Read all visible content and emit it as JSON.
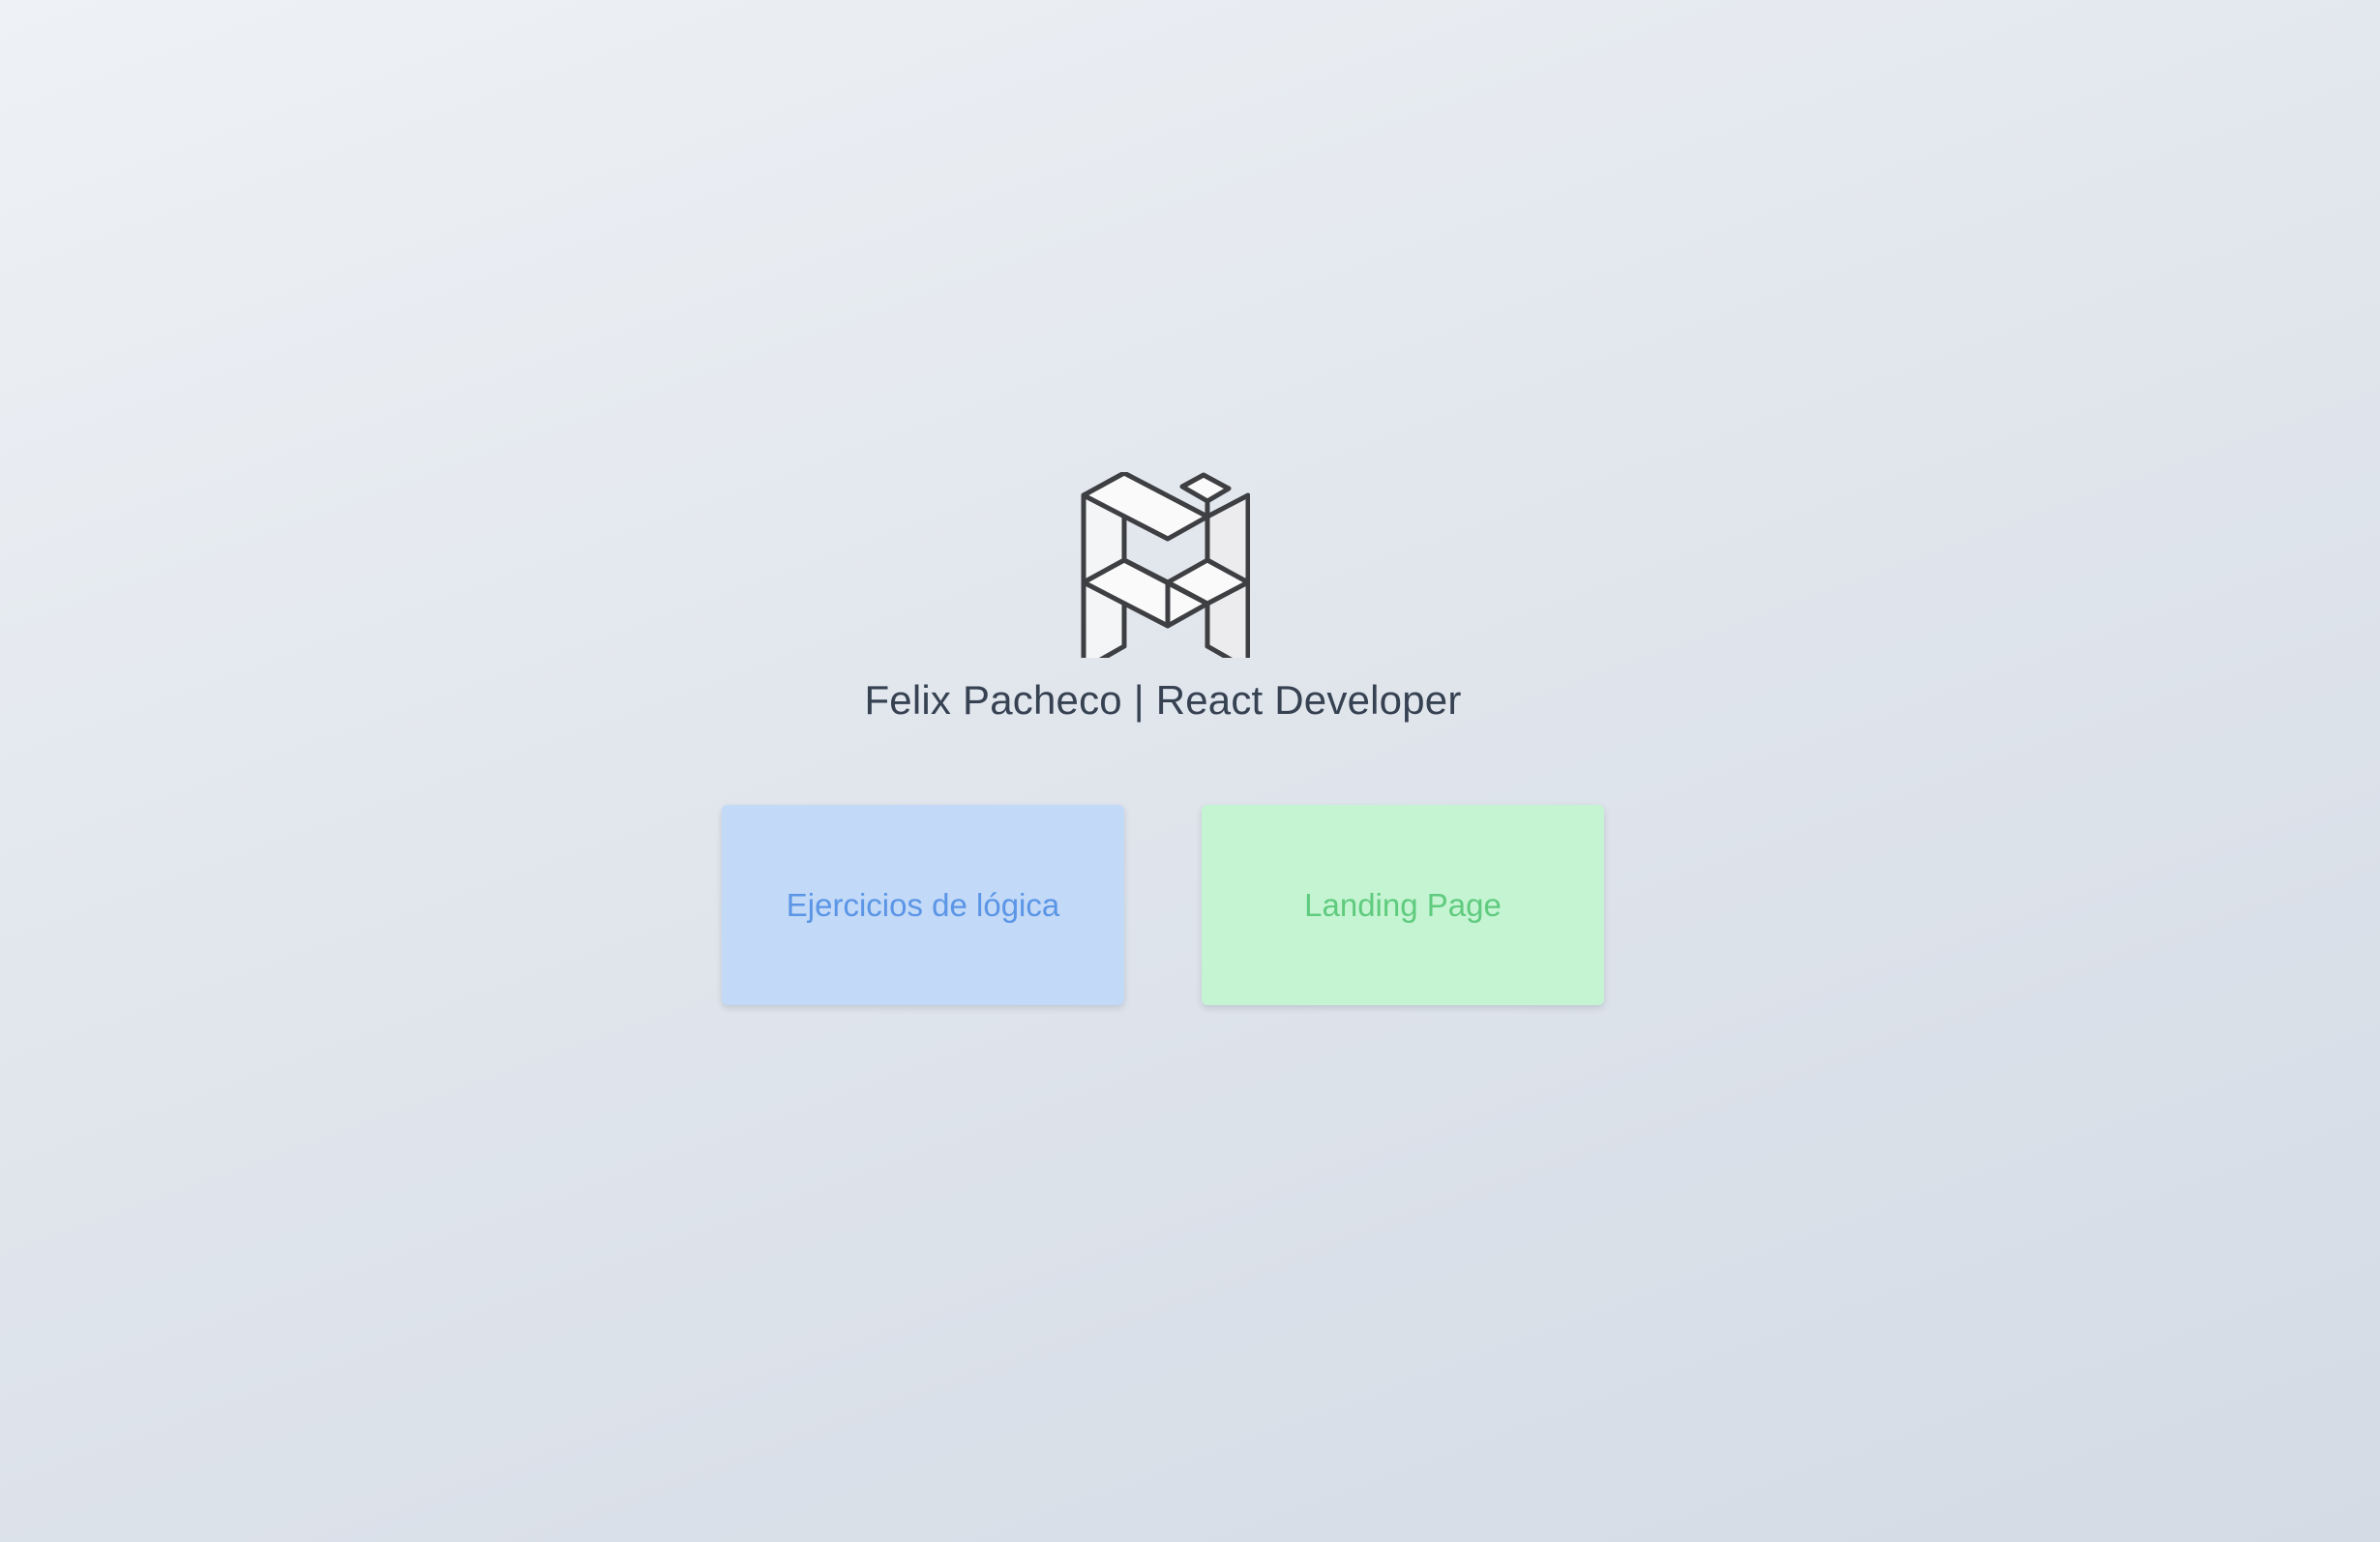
{
  "header": {
    "logo_icon": "geometric-monogram-logo-icon",
    "title": "Felix Pacheco | React Developer"
  },
  "cards": [
    {
      "label": "Ejercicios de lógica",
      "background": "#c2d9f7",
      "text_color": "#5b95e6"
    },
    {
      "label": "Landing Page",
      "background": "#c5f4d3",
      "text_color": "#5fcb7e"
    }
  ],
  "colors": {
    "background_start": "#eef1f5",
    "background_end": "#d4dbe5",
    "title": "#364152",
    "logo_stroke": "#3e3f42"
  }
}
